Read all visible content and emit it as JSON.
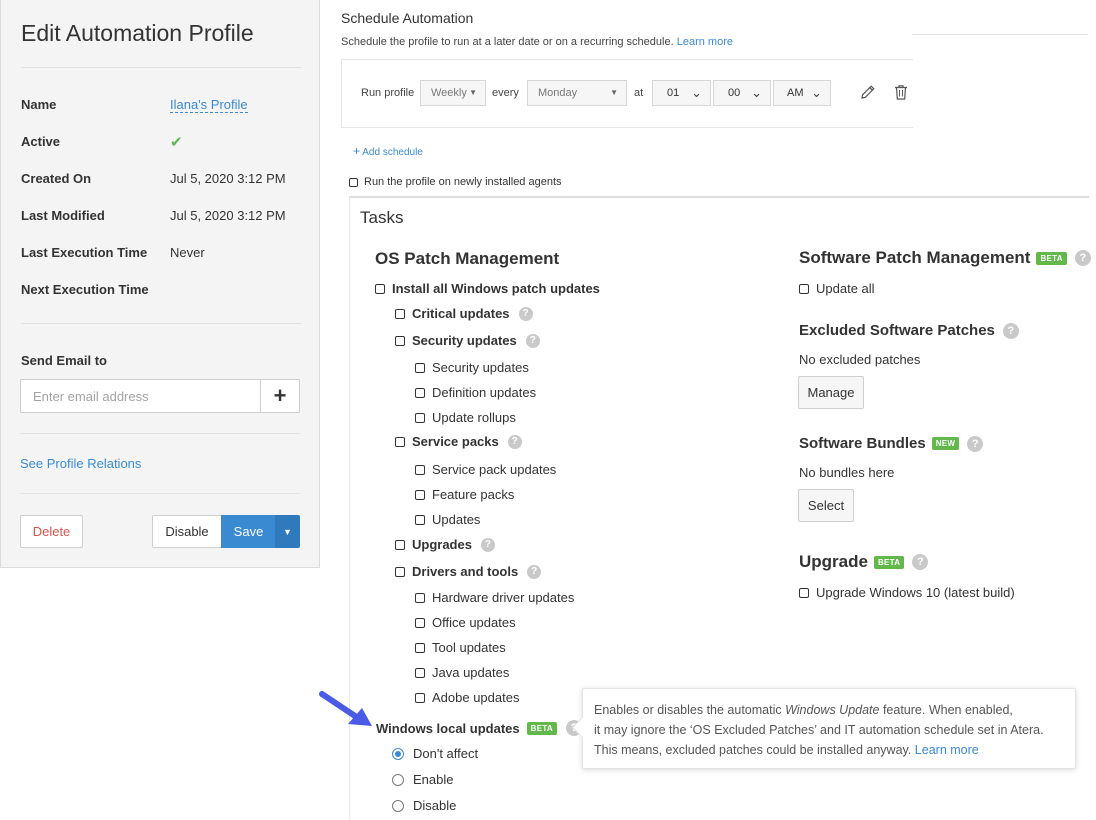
{
  "left_panel": {
    "title": "Edit Automation Profile",
    "fields": [
      {
        "label": "Name",
        "value": "Ilana's Profile"
      },
      {
        "label": "Active",
        "value": "✔"
      },
      {
        "label": "Created On",
        "value": "Jul 5, 2020 3:12 PM"
      },
      {
        "label": "Last Modified",
        "value": "Jul 5, 2020 3:12 PM"
      },
      {
        "label": "Last Execution Time",
        "value": "Never"
      },
      {
        "label": "Next Execution Time",
        "value": ""
      }
    ],
    "send_email_label": "Send Email to",
    "email_placeholder": "Enter email address",
    "add_email_icon": "plus-icon",
    "relations_link": "See Profile Relations",
    "delete_label": "Delete",
    "disable_label": "Disable",
    "save_label": "Save",
    "accent_color": "#3a8ad2",
    "danger_color": "#d9534f",
    "active_color": "#5cb85c"
  },
  "schedule": {
    "title": "Schedule Automation",
    "subtitle": "Schedule the profile to run at a later date or on a recurring schedule.",
    "learn_more": "Learn more",
    "run_profile_label": "Run profile",
    "frequency": "Weekly",
    "every_label": "every",
    "day": "Monday",
    "at_label": "at",
    "hour": "01",
    "minute": "00",
    "ampm": "AM",
    "edit_icon": "pencil-icon",
    "delete_icon": "trash-icon",
    "add_schedule": "Add schedule",
    "run_new_agents": "Run the profile on newly installed agents"
  },
  "tasks": {
    "title": "Tasks",
    "os_patch": {
      "title": "OS Patch Management",
      "install_all": "Install all Windows patch updates",
      "critical": "Critical updates",
      "security": "Security updates",
      "security_sub": [
        "Security updates",
        "Definition updates",
        "Update rollups"
      ],
      "service_packs": "Service packs",
      "service_sub": [
        "Service pack updates",
        "Feature packs",
        "Updates"
      ],
      "upgrades": "Upgrades",
      "drivers": "Drivers and tools",
      "drivers_sub": [
        "Hardware driver updates",
        "Office updates",
        "Tool updates",
        "Java updates",
        "Adobe updates"
      ],
      "windows_local": "Windows local updates",
      "windows_local_badge": "BETA",
      "radio_options": [
        "Don't affect",
        "Enable",
        "Disable"
      ],
      "radio_selected": "Don't affect"
    },
    "software_patch": {
      "title": "Software Patch Management",
      "badge": "BETA",
      "update_all": "Update all"
    },
    "excluded": {
      "title": "Excluded Software Patches",
      "empty": "No excluded patches",
      "button": "Manage"
    },
    "bundles": {
      "title": "Software Bundles",
      "badge": "NEW",
      "empty": "No bundles here",
      "button": "Select"
    },
    "upgrade": {
      "title": "Upgrade",
      "badge": "BETA",
      "option": "Upgrade Windows 10 (latest build)"
    },
    "help_icon": "?",
    "badge_color": "#62b84a"
  },
  "tooltip": {
    "line1_pre": "Enables or disables the automatic ",
    "line1_em": "Windows Update",
    "line1_post": " feature. When enabled,",
    "line2": "it may ignore the ‘OS Excluded Patches’ and IT automation schedule set in Atera.",
    "line3": "This means, excluded patches could be installed anyway.",
    "learn_more": "Learn more"
  },
  "annotation_arrow_color": "#4a5be6"
}
